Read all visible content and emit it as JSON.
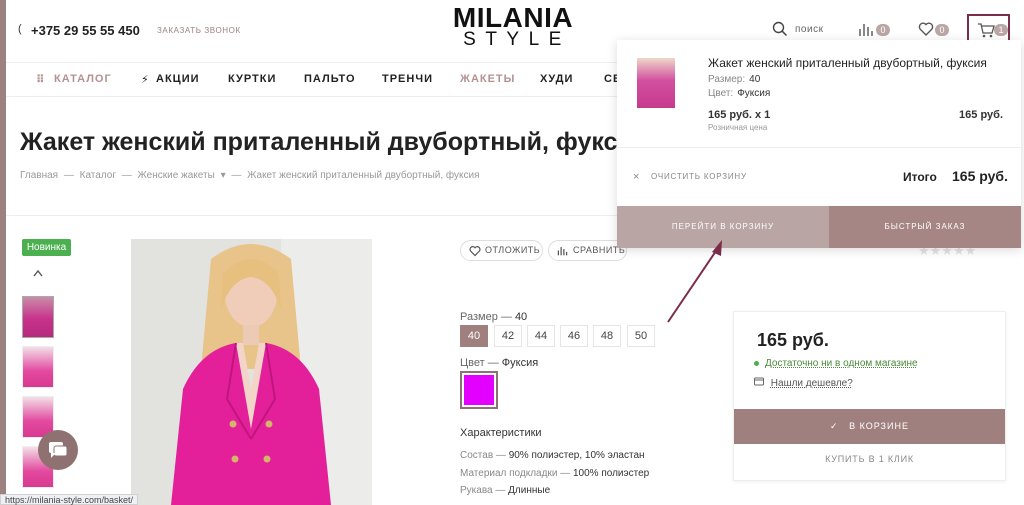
{
  "header": {
    "phone": "+375 29 55 55 450",
    "callback": "ЗАКАЗАТЬ ЗВОНОК",
    "logo_top": "MILANIA",
    "logo_bottom": "STYLE",
    "search_label": "поиск",
    "compare_count": "0",
    "favorites_count": "0",
    "cart_count": "1",
    "icons": [
      "phone-icon",
      "search-icon",
      "compare-icon",
      "heart-icon",
      "cart-icon"
    ]
  },
  "nav": {
    "items": [
      "КАТАЛОГ",
      "АКЦИИ",
      "КУРТКИ",
      "ПАЛЬТО",
      "ТРЕНЧИ",
      "ЖАКЕТЫ",
      "ХУДИ",
      "СВ"
    ],
    "active": "ЖАКЕТЫ"
  },
  "product": {
    "title": "Жакет женский приталенный двубортный, фуксия",
    "breadcrumb": [
      "Главная",
      "Каталог",
      "Женские жакеты",
      "Жакет женский приталенный двубортный, фуксия"
    ],
    "badge": "Новинка",
    "save_label": "ОТЛОЖИТЬ",
    "compare_label": "СРАВНИТЬ",
    "size_label": "Размер",
    "size_value": "40",
    "sizes": [
      "40",
      "42",
      "44",
      "46",
      "48",
      "50"
    ],
    "selected_size": "40",
    "color_label": "Цвет",
    "color_value": "Фуксия",
    "color_hex": "#e300ff",
    "characteristics_title": "Характеристики",
    "characteristics": [
      {
        "label": "Состав",
        "value": "90% полиэстер, 10% эластан"
      },
      {
        "label": "Материал подкладки",
        "value": "100% полиэстер"
      },
      {
        "label": "Рукава",
        "value": "Длинные"
      }
    ]
  },
  "pricebox": {
    "price": "165 руб.",
    "availability": "Достаточно ни в одном магазине",
    "cheaper": "Нашли дешевле?",
    "in_cart": "В КОРЗИНЕ",
    "one_click": "КУПИТЬ В 1 КЛИК"
  },
  "cart_dropdown": {
    "item_name": "Жакет женский приталенный двубортный, фуксия",
    "size_label": "Размер:",
    "size_value": "40",
    "color_label": "Цвет:",
    "color_value": "Фуксия",
    "qty_price": "165 руб. x 1",
    "retail_label": "Розничная цена",
    "line_total": "165 руб.",
    "clear_label": "ОЧИСТИТЬ КОРЗИНУ",
    "total_label": "Итого",
    "total_value": "165 руб.",
    "go_to_cart": "ПЕРЕЙТИ В КОРЗИНУ",
    "quick_order": "БЫСТРЫЙ ЗАКАЗ"
  },
  "status_bar": {
    "url": "https://milania-style.com/basket/"
  },
  "colors": {
    "accent": "#9c8180",
    "highlight_box": "#7b2c4a",
    "arrow": "#7b2c4a",
    "badge_green": "#4caf50"
  }
}
